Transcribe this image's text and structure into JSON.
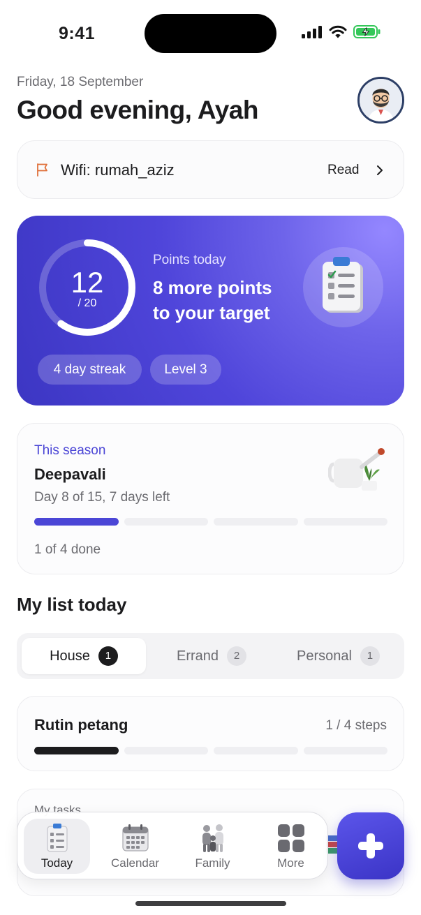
{
  "status_bar": {
    "time": "9:41"
  },
  "header": {
    "date": "Friday, 18 September",
    "greeting": "Good evening, Ayah"
  },
  "note": {
    "text": "Wifi: rumah_aziz",
    "action": "Read"
  },
  "points": {
    "current": "12",
    "target": "/ 20",
    "progress_fraction": 0.6,
    "label": "Points today",
    "message": "8 more points to your target",
    "streak": "4 day streak",
    "level": "Level 3"
  },
  "season": {
    "eyebrow": "This season",
    "title": "Deepavali",
    "subtitle": "Day 8 of 15, 7 days left",
    "done": "1 of 4 done",
    "segments_total": 4,
    "segments_done": 1
  },
  "list": {
    "heading": "My list today",
    "tabs": [
      {
        "label": "House",
        "count": "1",
        "active": true
      },
      {
        "label": "Errand",
        "count": "2",
        "active": false
      },
      {
        "label": "Personal",
        "count": "1",
        "active": false
      }
    ]
  },
  "routine": {
    "title": "Rutin petang",
    "steps": "1 / 4 steps",
    "segments_total": 4,
    "segments_done": 1
  },
  "tasks": {
    "label": "My tasks"
  },
  "nav": {
    "items": [
      {
        "label": "Today",
        "icon": "clipboard-icon",
        "active": true
      },
      {
        "label": "Calendar",
        "icon": "calendar-icon",
        "active": false
      },
      {
        "label": "Family",
        "icon": "family-icon",
        "active": false
      },
      {
        "label": "More",
        "icon": "grid-icon",
        "active": false
      }
    ]
  },
  "fab": {
    "icon": "plus-icon"
  },
  "colors": {
    "accent": "#4b46d6",
    "hero_start": "#9487ff",
    "hero_end": "#3c36c3",
    "text": "#1c1c1e",
    "muted": "#6b6b70",
    "flag": "#e0703a"
  }
}
